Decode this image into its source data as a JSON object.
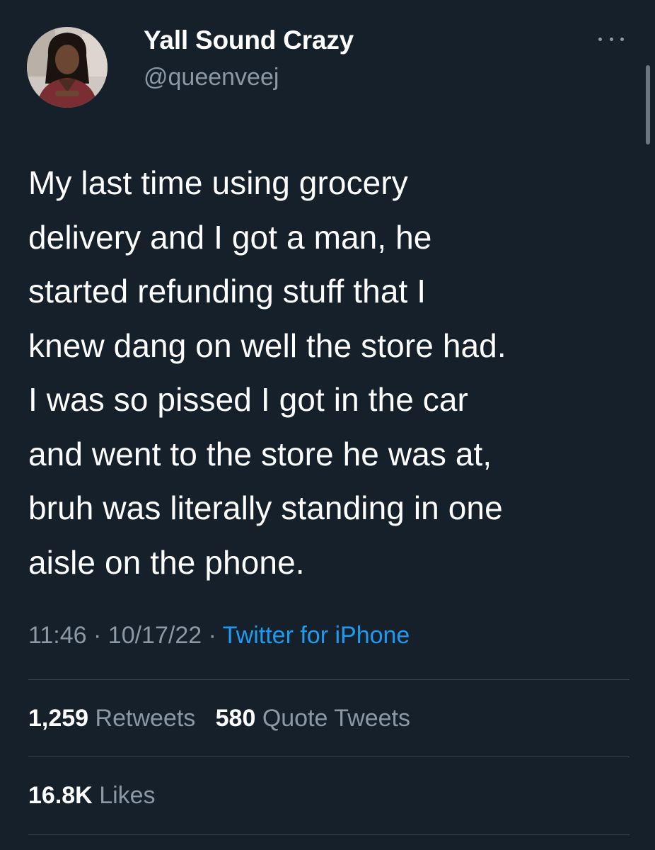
{
  "author": {
    "display_name": "Yall Sound Crazy",
    "handle": "@queenveej"
  },
  "icons": {
    "more": "more-horizontal-icon"
  },
  "tweet": {
    "lines": [
      "My last time using grocery",
      "delivery and I got a man, he",
      "started refunding stuff that I",
      "knew dang on well the store had.",
      "I was so pissed I got in the car",
      "and went to the store he was at,",
      "bruh was literally standing in one",
      "aisle on the phone."
    ],
    "time": "11:46",
    "separator": "·",
    "date": "10/17/22",
    "source": "Twitter for iPhone"
  },
  "stats": {
    "retweets_count": "1,259",
    "retweets_label": "Retweets",
    "quotes_count": "580",
    "quotes_label": "Quote Tweets",
    "likes_count": "16.8K",
    "likes_label": "Likes"
  },
  "colors": {
    "background": "#15202b",
    "text_primary": "#ffffff",
    "text_secondary": "#8b98a5",
    "link": "#1d9bf0",
    "divider": "#38444d"
  }
}
